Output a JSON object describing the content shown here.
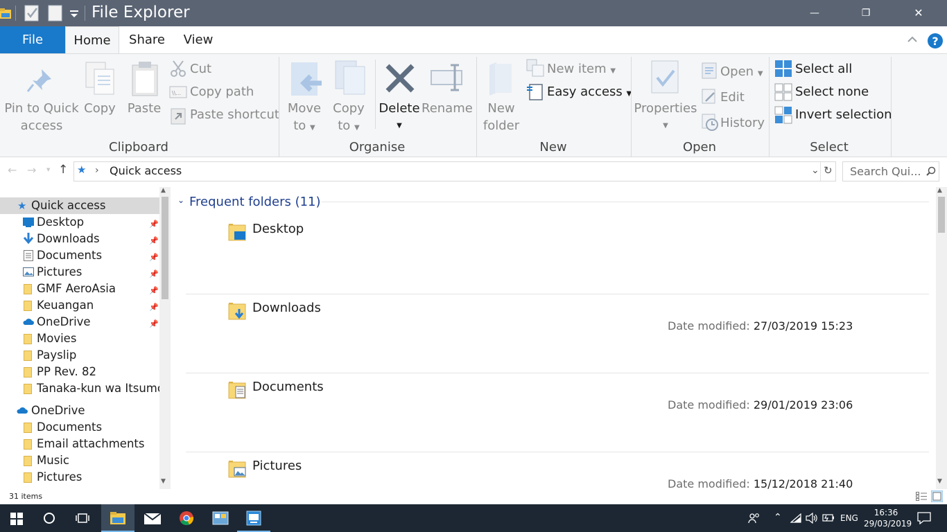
{
  "window": {
    "title": "File Explorer",
    "controls": {
      "minimize": "—",
      "maximize": "❐",
      "close": "✕"
    }
  },
  "ribbon_tabs": {
    "file": "File",
    "home": "Home",
    "share": "Share",
    "view": "View"
  },
  "ribbon": {
    "clipboard": {
      "group": "Clipboard",
      "pin_line1": "Pin to Quick",
      "pin_line2": "access",
      "copy": "Copy",
      "paste": "Paste",
      "cut": "Cut",
      "copy_path": "Copy path",
      "paste_shortcut": "Paste shortcut"
    },
    "organise": {
      "group": "Organise",
      "move_line1": "Move",
      "move_line2": "to",
      "copyto_line1": "Copy",
      "copyto_line2": "to",
      "delete": "Delete",
      "rename": "Rename"
    },
    "new": {
      "group": "New",
      "new_item": "New item",
      "easy_access": "Easy access",
      "newfolder_line1": "New",
      "newfolder_line2": "folder"
    },
    "open": {
      "group": "Open",
      "properties": "Properties",
      "open": "Open",
      "edit": "Edit",
      "history": "History"
    },
    "select": {
      "group": "Select",
      "select_all": "Select all",
      "select_none": "Select none",
      "invert": "Invert selection"
    }
  },
  "address": {
    "path": "Quick access",
    "search_placeholder": "Search Qui..."
  },
  "nav": {
    "quick_access": "Quick access",
    "pinned": [
      {
        "label": "Desktop"
      },
      {
        "label": "Downloads"
      },
      {
        "label": "Documents"
      },
      {
        "label": "Pictures"
      },
      {
        "label": "GMF AeroAsia"
      },
      {
        "label": "Keuangan"
      },
      {
        "label": "OneDrive"
      }
    ],
    "recent": [
      {
        "label": "Movies"
      },
      {
        "label": "Payslip"
      },
      {
        "label": "PP Rev. 82"
      },
      {
        "label": "Tanaka-kun wa Itsumo"
      }
    ],
    "onedrive": "OneDrive",
    "onedrive_items": [
      {
        "label": "Documents"
      },
      {
        "label": "Email attachments"
      },
      {
        "label": "Music"
      },
      {
        "label": "Pictures"
      }
    ]
  },
  "content": {
    "section_title": "Frequent folders (11)",
    "date_label": "Date modified:",
    "entries": [
      {
        "name": "Desktop",
        "date": ""
      },
      {
        "name": "Downloads",
        "date": "27/03/2019 15:23"
      },
      {
        "name": "Documents",
        "date": "29/01/2019 23:06"
      },
      {
        "name": "Pictures",
        "date": "15/12/2018 21:40"
      }
    ]
  },
  "status": {
    "items": "31 items"
  },
  "taskbar": {
    "lang": "ENG",
    "time": "16:36",
    "date": "29/03/2019"
  },
  "colors": {
    "titlebar": "#5a6473",
    "file_tab": "#1979ca",
    "accent_text": "#1f3f8f",
    "taskbar": "#1c2733"
  }
}
